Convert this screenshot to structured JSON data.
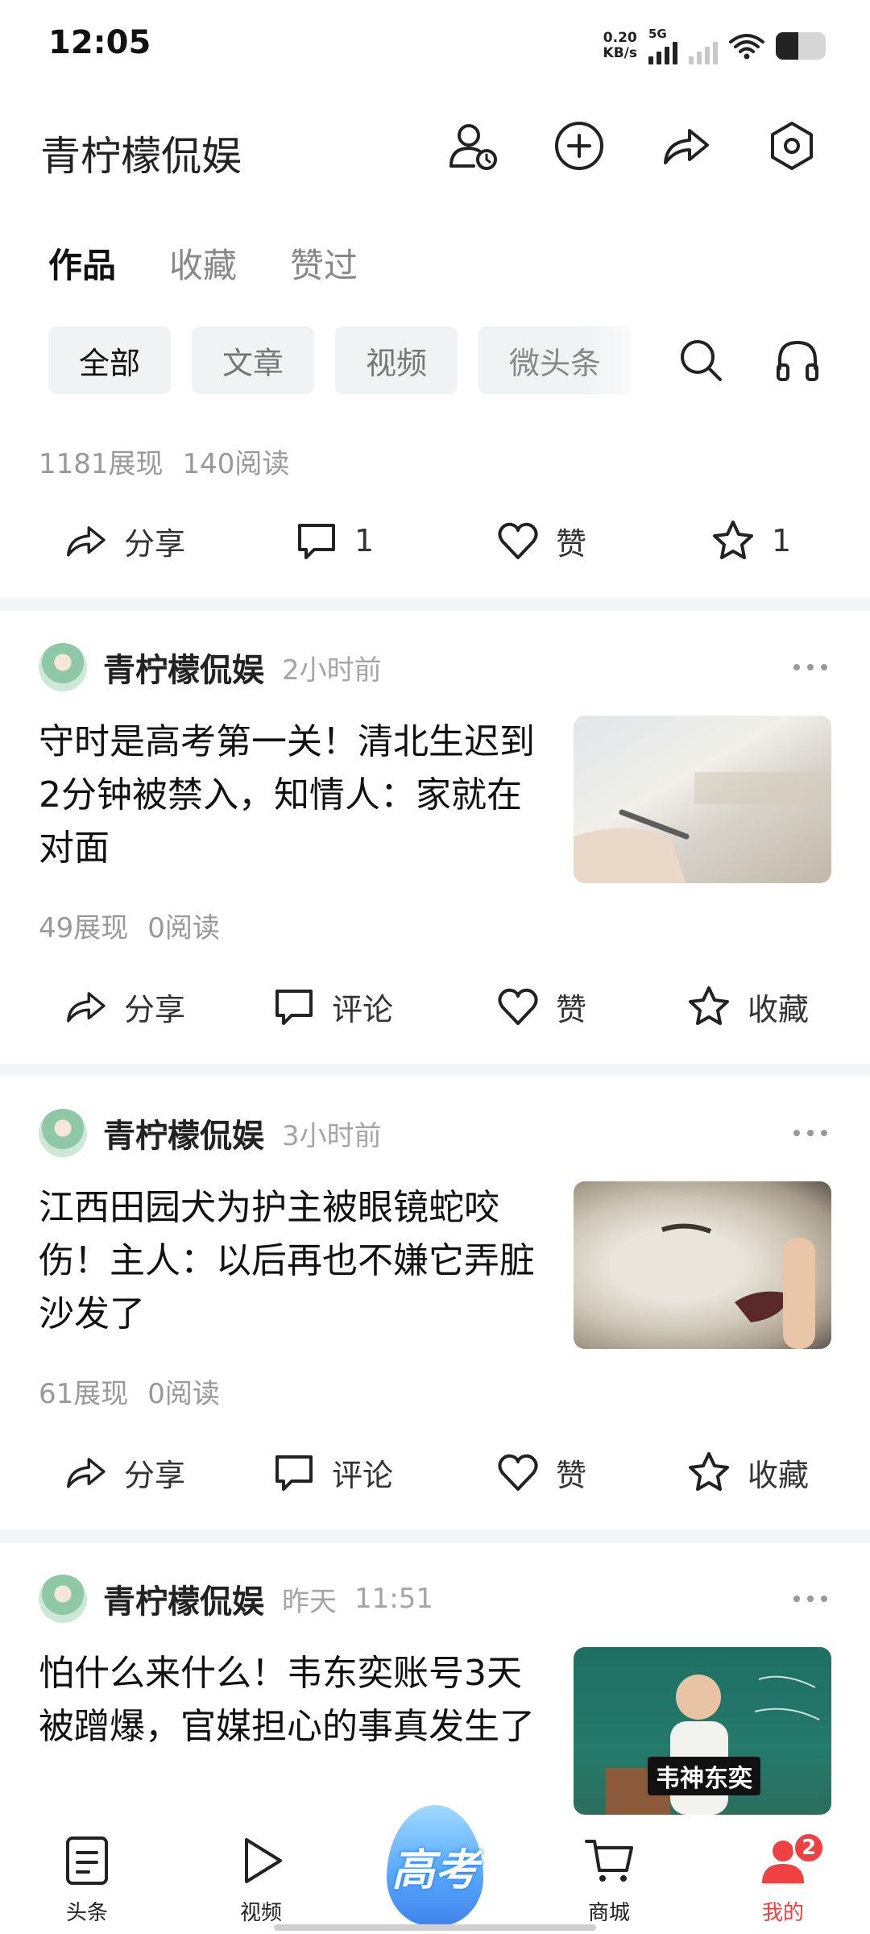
{
  "status": {
    "time": "12:05",
    "net_speed_value": "0.20",
    "net_speed_unit": "KB/s",
    "signal_label": "5G"
  },
  "header": {
    "profile_name": "青柠檬侃娱"
  },
  "tabs": [
    {
      "label": "作品"
    },
    {
      "label": "收藏"
    },
    {
      "label": "赞过"
    }
  ],
  "filters": [
    {
      "label": "全部"
    },
    {
      "label": "文章"
    },
    {
      "label": "视频"
    },
    {
      "label": "微头条"
    }
  ],
  "first_post_partial": {
    "impressions": "1181展现",
    "reads": "140阅读",
    "share_label": "分享",
    "comment_count": "1",
    "like_label": "赞",
    "favorite_count": "1"
  },
  "posts": [
    {
      "author": "青柠檬侃娱",
      "time": "2小时前",
      "title": "守时是高考第一关！清北生迟到2分钟被禁入，知情人：家就在对面",
      "impressions": "49展现",
      "reads": "0阅读",
      "share_label": "分享",
      "comment_label": "评论",
      "like_label": "赞",
      "favorite_label": "收藏"
    },
    {
      "author": "青柠檬侃娱",
      "time": "3小时前",
      "title": "江西田园犬为护主被眼镜蛇咬伤！主人：以后再也不嫌它弄脏沙发了",
      "impressions": "61展现",
      "reads": "0阅读",
      "share_label": "分享",
      "comment_label": "评论",
      "like_label": "赞",
      "favorite_label": "收藏"
    },
    {
      "author": "青柠檬侃娱",
      "time": "昨天",
      "time_detail": "11:51",
      "title": "怕什么来什么！韦东奕账号3天被蹭爆，官媒担心的事真发生了",
      "thumb_caption": "韦神东奕"
    }
  ],
  "bottom_nav": {
    "items": [
      {
        "label": "头条"
      },
      {
        "label": "视频"
      },
      {
        "label": "商城"
      },
      {
        "label": "我的"
      }
    ],
    "center_label": "高考",
    "badge_count": "2"
  },
  "colors": {
    "accent_red": "#f04142",
    "text_primary": "#111111",
    "text_muted": "#999999",
    "chip_bg": "#f1f2f4",
    "center_blue": "#3b9bff"
  }
}
